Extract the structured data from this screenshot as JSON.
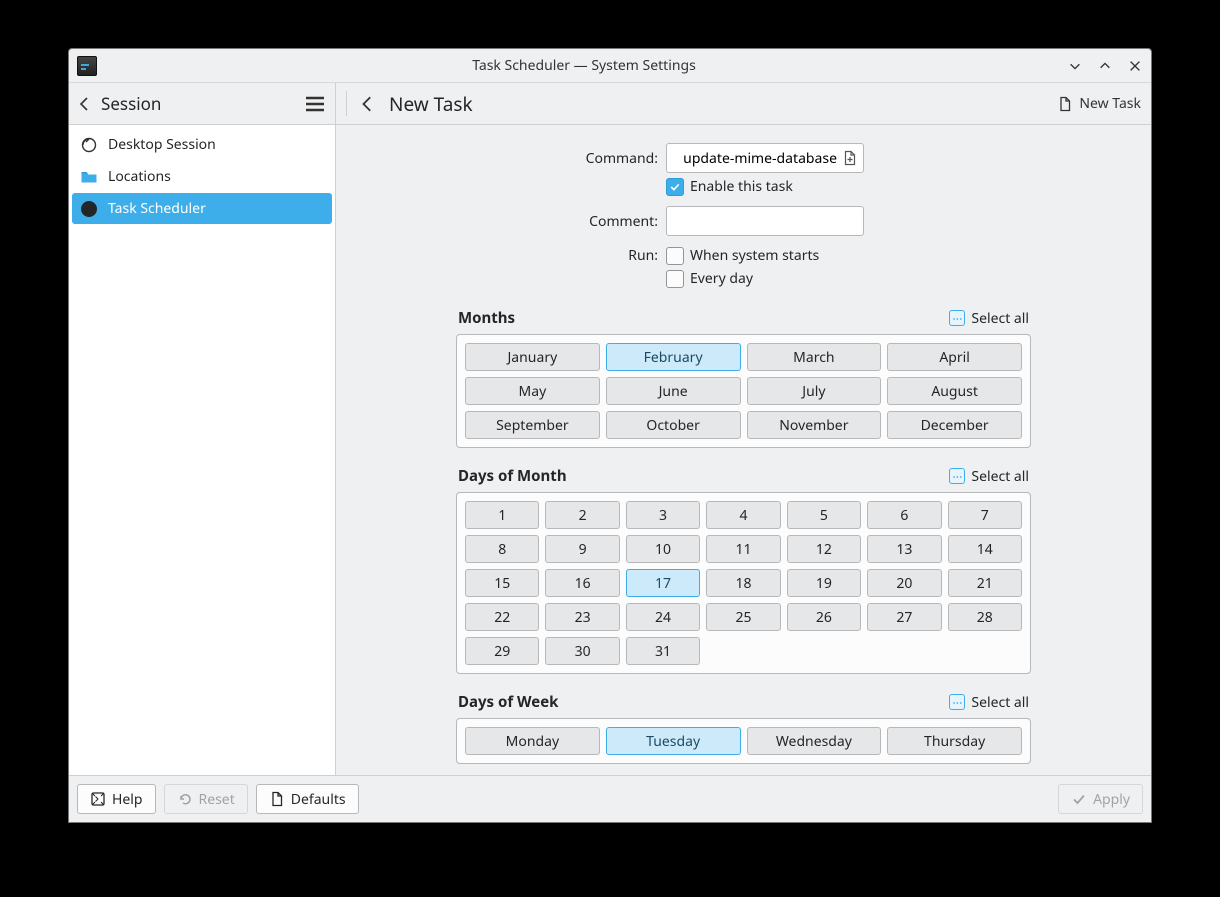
{
  "titlebar": {
    "title": "Task Scheduler — System Settings"
  },
  "toolbar": {
    "session_label": "Session",
    "page_title": "New Task",
    "new_task_label": "New Task"
  },
  "sidebar": {
    "items": [
      {
        "label": "Desktop Session"
      },
      {
        "label": "Locations"
      },
      {
        "label": "Task Scheduler",
        "selected": true
      }
    ]
  },
  "form": {
    "command_label": "Command:",
    "command_value": "update-mime-database",
    "enable_label": "Enable this task",
    "enable_checked": true,
    "comment_label": "Comment:",
    "comment_value": "",
    "run_label": "Run:",
    "run_system_starts": "When system starts",
    "run_every_day": "Every day"
  },
  "sections": {
    "select_all": "Select all",
    "months": {
      "title": "Months",
      "items": [
        "January",
        "February",
        "March",
        "April",
        "May",
        "June",
        "July",
        "August",
        "September",
        "October",
        "November",
        "December"
      ],
      "selected": [
        1
      ]
    },
    "days_of_month": {
      "title": "Days of Month",
      "items": [
        "1",
        "2",
        "3",
        "4",
        "5",
        "6",
        "7",
        "8",
        "9",
        "10",
        "11",
        "12",
        "13",
        "14",
        "15",
        "16",
        "17",
        "18",
        "19",
        "20",
        "21",
        "22",
        "23",
        "24",
        "25",
        "26",
        "27",
        "28",
        "29",
        "30",
        "31"
      ],
      "selected": [
        16
      ]
    },
    "days_of_week": {
      "title": "Days of Week",
      "items": [
        "Monday",
        "Tuesday",
        "Wednesday",
        "Thursday"
      ],
      "selected": [
        1
      ]
    }
  },
  "footer": {
    "help": "Help",
    "reset": "Reset",
    "defaults": "Defaults",
    "apply": "Apply"
  }
}
